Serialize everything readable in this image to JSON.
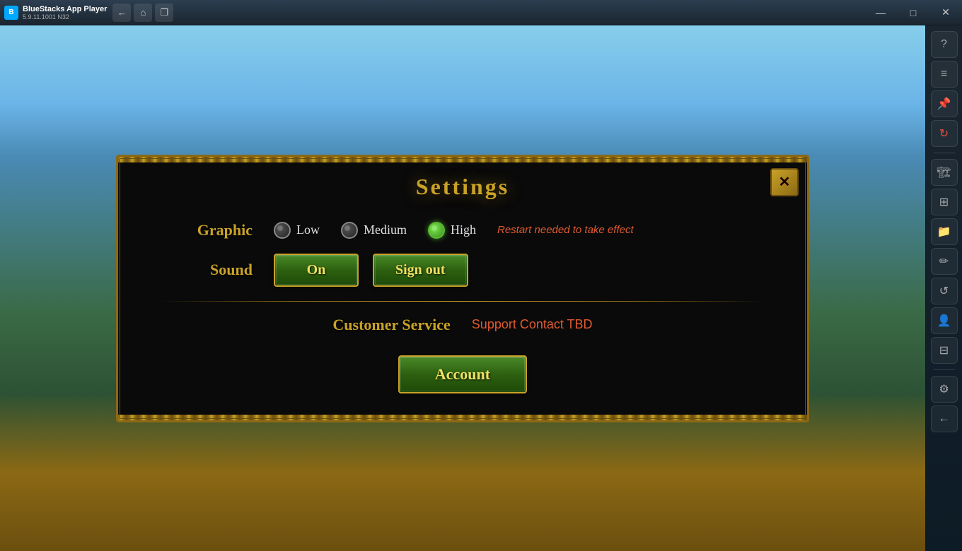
{
  "titlebar": {
    "app_name": "BlueStacks App Player",
    "version": "5.9.11.1001 N32",
    "back_btn": "←",
    "home_btn": "⌂",
    "window_btn": "❐",
    "minimize_btn": "—",
    "maximize_btn": "□",
    "close_btn": "✕"
  },
  "sidebar": {
    "buttons": [
      {
        "name": "question-icon",
        "icon": "?"
      },
      {
        "name": "menu-icon",
        "icon": "≡"
      },
      {
        "name": "pin-icon",
        "icon": "📌"
      },
      {
        "name": "refresh-icon",
        "icon": "↻"
      },
      {
        "name": "build-icon",
        "icon": "🏗"
      },
      {
        "name": "layers-icon",
        "icon": "⊞"
      },
      {
        "name": "folder-icon",
        "icon": "📁"
      },
      {
        "name": "brush-icon",
        "icon": "✏"
      },
      {
        "name": "rotate-icon",
        "icon": "↺"
      },
      {
        "name": "person-icon",
        "icon": "👤"
      },
      {
        "name": "stack-icon",
        "icon": "⊟"
      },
      {
        "name": "gear-icon",
        "icon": "⚙"
      },
      {
        "name": "arrow-left-icon",
        "icon": "←"
      }
    ]
  },
  "dialog": {
    "title": "Settings",
    "close_label": "✕",
    "graphic_label": "Graphic",
    "graphic_options": [
      {
        "label": "Low",
        "selected": false
      },
      {
        "label": "Medium",
        "selected": false
      },
      {
        "label": "High",
        "selected": true
      }
    ],
    "restart_notice": "Restart needed to take effect",
    "sound_label": "Sound",
    "sound_on_label": "On",
    "sign_out_label": "Sign out",
    "customer_service_label": "Customer Service",
    "support_text": "Support Contact TBD",
    "account_label": "Account"
  }
}
